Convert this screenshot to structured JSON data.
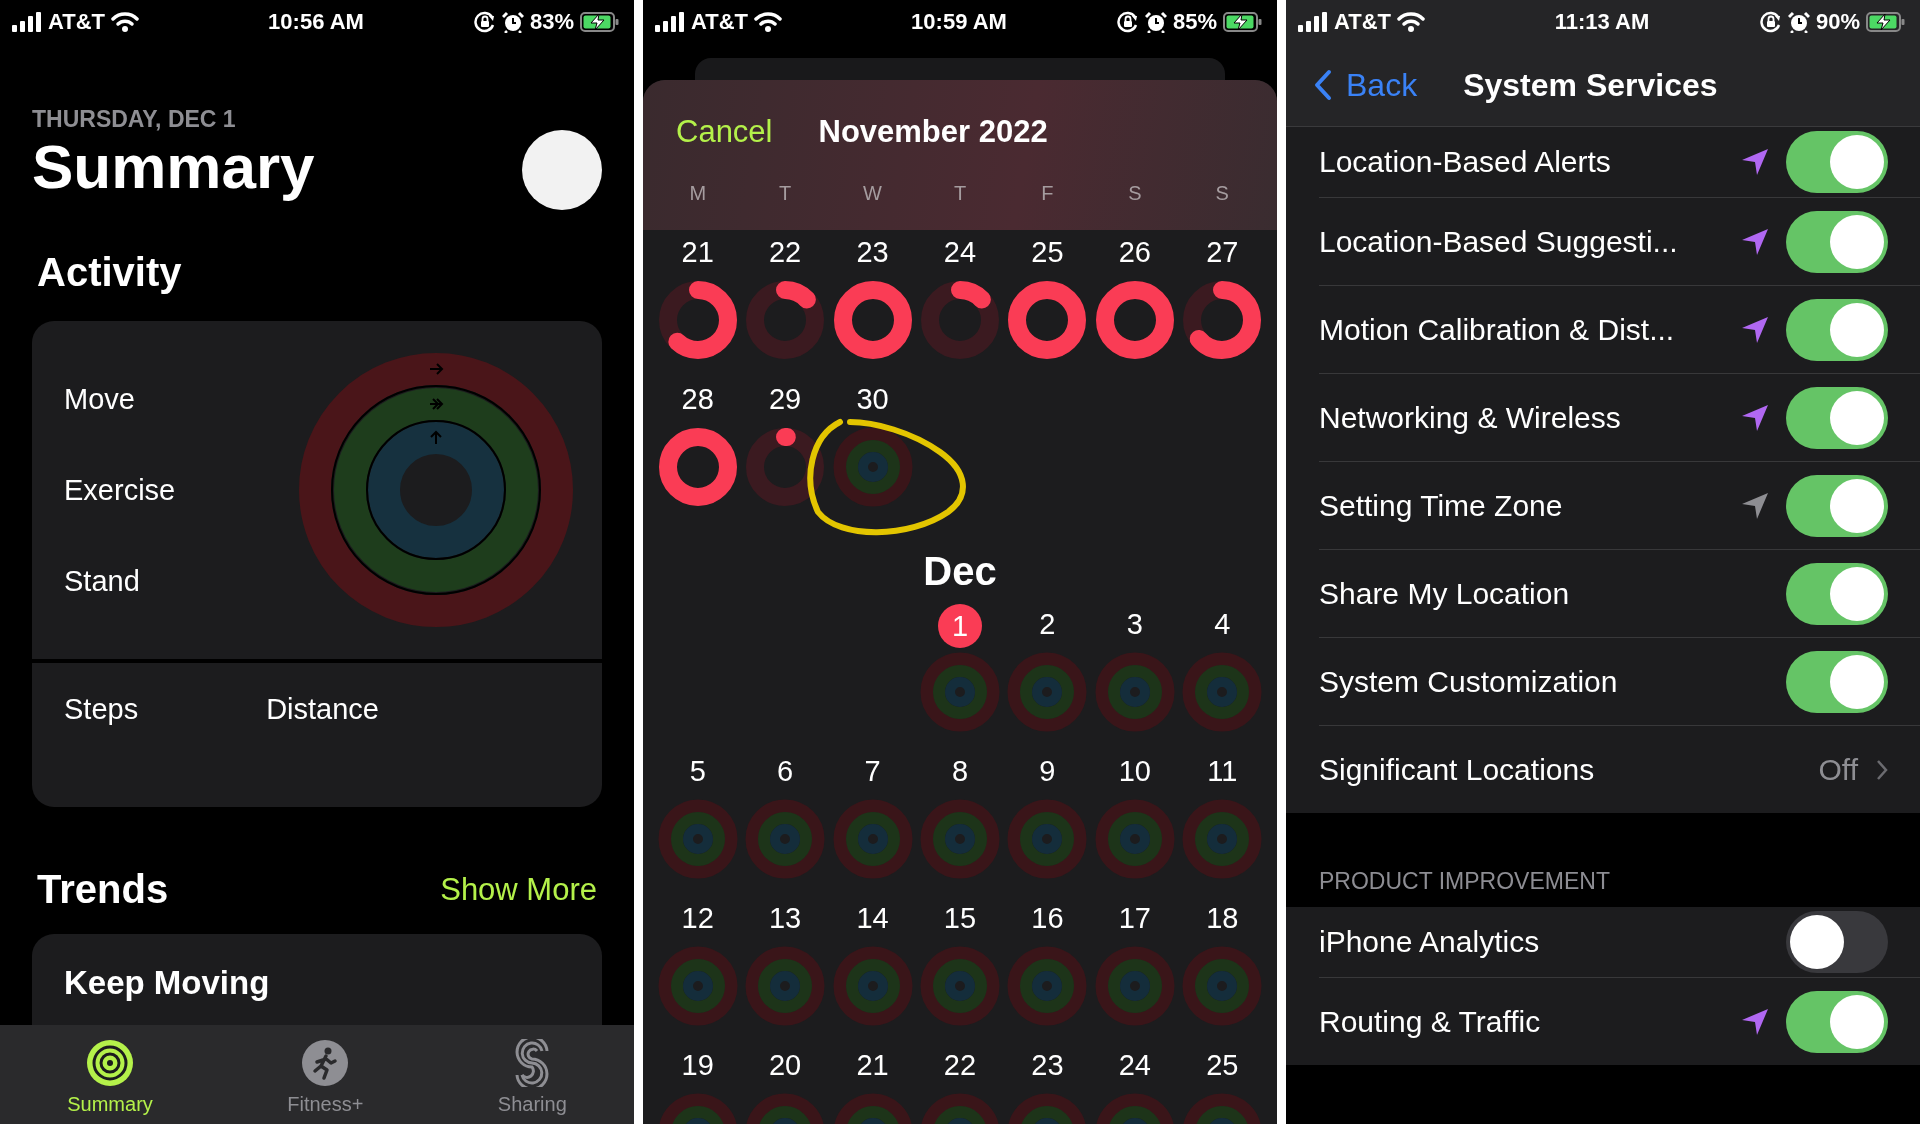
{
  "summary_screen": {
    "status_bar": {
      "carrier": "AT&T",
      "time": "10:56 AM",
      "battery": "83%"
    },
    "date": "THURSDAY, DEC 1",
    "title": "Summary",
    "activity_heading": "Activity",
    "ring_labels": [
      "Move",
      "Exercise",
      "Stand"
    ],
    "stats": [
      "Steps",
      "Distance"
    ],
    "trends_heading": "Trends",
    "show_more": "Show More",
    "trend_card_title": "Keep Moving",
    "tab_bar": [
      {
        "label": "Summary",
        "selected": true
      },
      {
        "label": "Fitness+",
        "selected": false
      },
      {
        "label": "Sharing",
        "selected": false
      }
    ]
  },
  "calendar_screen": {
    "status_bar": {
      "carrier": "AT&T",
      "time": "10:59 AM",
      "battery": "85%"
    },
    "cancel": "Cancel",
    "title": "November 2022",
    "weekdays": [
      "M",
      "T",
      "W",
      "T",
      "F",
      "S",
      "S"
    ],
    "months": [
      {
        "weeks": [
          {
            "days": [
              {
                "label": "21",
                "kind": "move",
                "level": 0.62
              },
              {
                "label": "22",
                "kind": "move",
                "level": 0.13
              },
              {
                "label": "23",
                "kind": "move",
                "level": 1
              },
              {
                "label": "24",
                "kind": "move",
                "level": 0.13
              },
              {
                "label": "25",
                "kind": "move",
                "level": 1
              },
              {
                "label": "26",
                "kind": "move",
                "level": 1
              },
              {
                "label": "27",
                "kind": "move",
                "level": 0.64
              }
            ]
          },
          {
            "days": [
              {
                "label": "28",
                "kind": "move",
                "level": 1
              },
              {
                "label": "29",
                "kind": "move",
                "level": 0.01
              },
              {
                "label": "30",
                "kind": "empty",
                "highlighted": true
              }
            ]
          }
        ]
      },
      {
        "label": "Dec",
        "weeks": [
          {
            "days": [
              {
                "kind": "blank"
              },
              {
                "kind": "blank"
              },
              {
                "kind": "blank"
              },
              {
                "label": "1",
                "kind": "empty",
                "today": true
              },
              {
                "label": "2",
                "kind": "empty"
              },
              {
                "label": "3",
                "kind": "empty"
              },
              {
                "label": "4",
                "kind": "empty"
              }
            ]
          },
          {
            "days": [
              {
                "label": "5",
                "kind": "empty"
              },
              {
                "label": "6",
                "kind": "empty"
              },
              {
                "label": "7",
                "kind": "empty"
              },
              {
                "label": "8",
                "kind": "empty"
              },
              {
                "label": "9",
                "kind": "empty"
              },
              {
                "label": "10",
                "kind": "empty"
              },
              {
                "label": "11",
                "kind": "empty"
              }
            ]
          },
          {
            "days": [
              {
                "label": "12",
                "kind": "empty"
              },
              {
                "label": "13",
                "kind": "empty"
              },
              {
                "label": "14",
                "kind": "empty"
              },
              {
                "label": "15",
                "kind": "empty"
              },
              {
                "label": "16",
                "kind": "empty"
              },
              {
                "label": "17",
                "kind": "empty"
              },
              {
                "label": "18",
                "kind": "empty"
              }
            ]
          },
          {
            "days": [
              {
                "label": "19",
                "kind": "empty"
              },
              {
                "label": "20",
                "kind": "empty"
              },
              {
                "label": "21",
                "kind": "empty"
              },
              {
                "label": "22",
                "kind": "empty"
              },
              {
                "label": "23",
                "kind": "empty"
              },
              {
                "label": "24",
                "kind": "empty"
              },
              {
                "label": "25",
                "kind": "empty"
              }
            ]
          }
        ]
      }
    ]
  },
  "settings_screen": {
    "status_bar": {
      "carrier": "AT&T",
      "time": "11:13 AM",
      "battery": "90%"
    },
    "back": "Back",
    "title": "System Services",
    "groups": [
      {
        "rows": [
          {
            "label": "Location-Based Alerts",
            "kind": "toggle",
            "on": true,
            "location_icon": {
              "color": "#b168f2"
            }
          },
          {
            "label": "Location-Based Suggesti...",
            "kind": "toggle",
            "on": true,
            "location_icon": {
              "color": "#b168f2"
            }
          },
          {
            "label": "Motion Calibration & Dist...",
            "kind": "toggle",
            "on": true,
            "location_icon": {
              "color": "#b168f2"
            }
          },
          {
            "label": "Networking & Wireless",
            "kind": "toggle",
            "on": true,
            "location_icon": {
              "color": "#b168f2"
            }
          },
          {
            "label": "Setting Time Zone",
            "kind": "toggle",
            "on": true,
            "location_icon": {
              "color": "#8e8e93"
            }
          },
          {
            "label": "Share My Location",
            "kind": "toggle",
            "on": true
          },
          {
            "label": "System Customization",
            "kind": "toggle",
            "on": true
          },
          {
            "label": "Significant Locations",
            "kind": "link",
            "value": "Off"
          }
        ]
      },
      {
        "header": "PRODUCT IMPROVEMENT",
        "rows": [
          {
            "label": "iPhone Analytics",
            "kind": "toggle",
            "on": false
          },
          {
            "label": "Routing & Traffic",
            "kind": "toggle",
            "on": true,
            "location_icon": {
              "color": "#b168f2"
            }
          }
        ]
      }
    ]
  }
}
